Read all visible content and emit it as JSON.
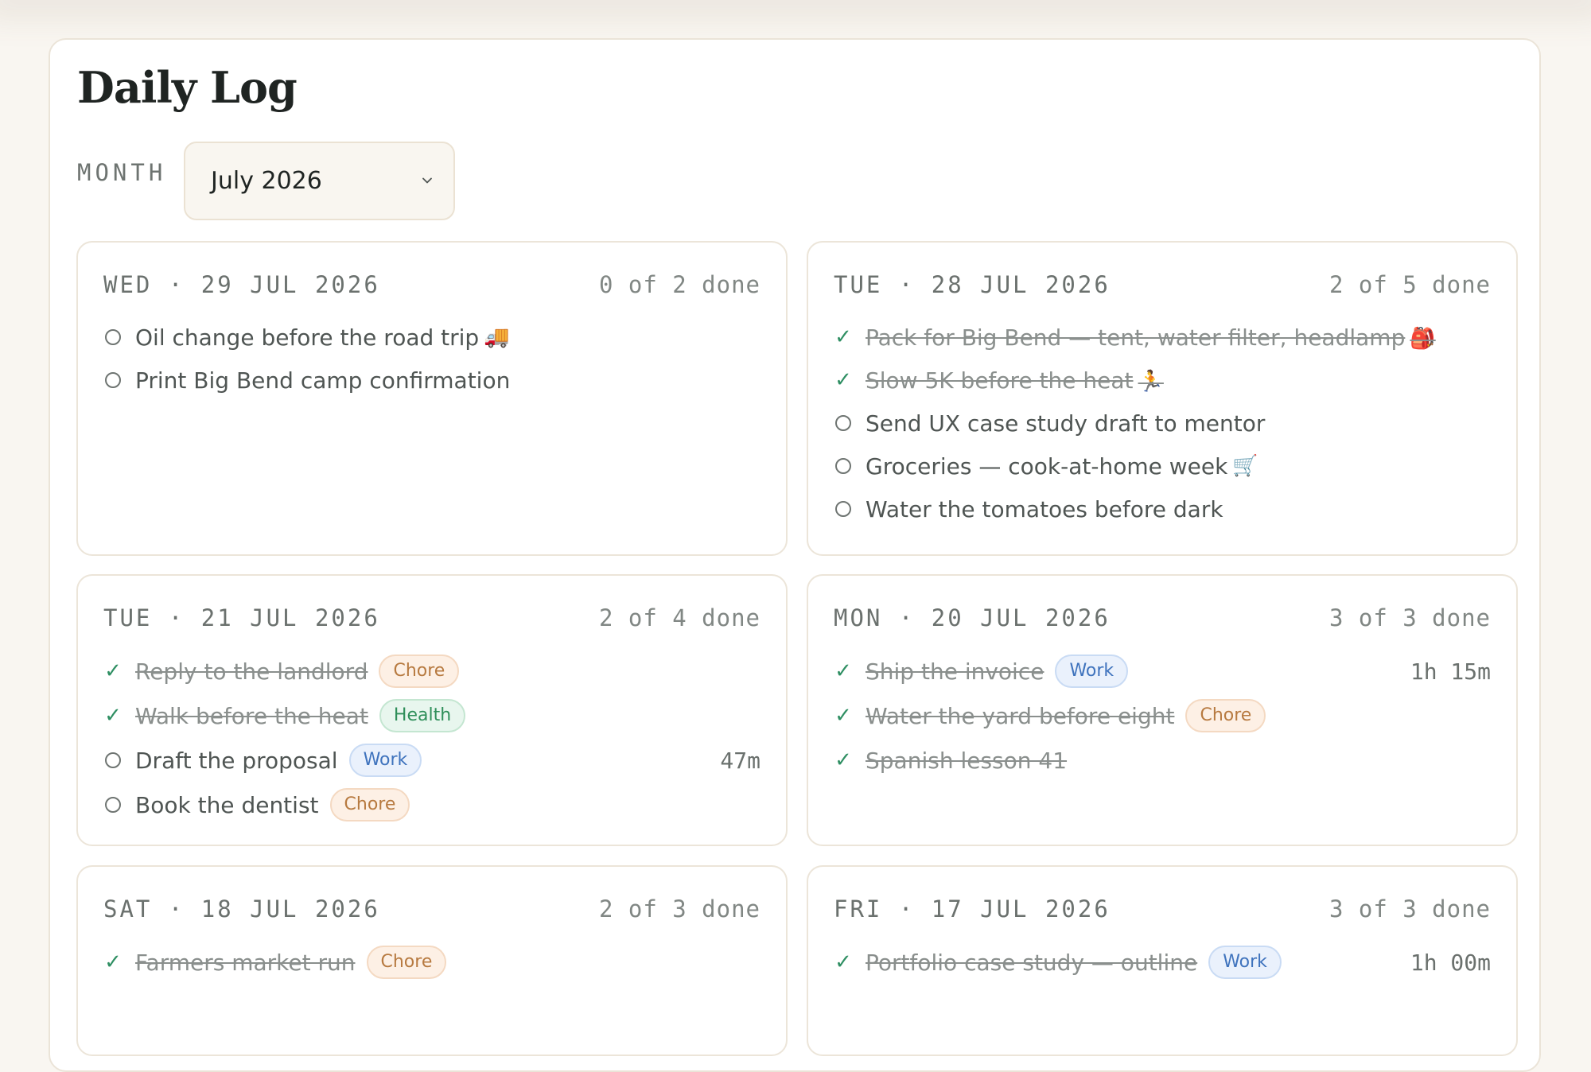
{
  "app": {
    "title": "Daily Log",
    "month_label": "MONTH",
    "month_value": "July 2026"
  },
  "colors": {
    "background": "#f9f6f1",
    "done_check": "#2f8f63",
    "tag_chore": "#b77a40",
    "tag_work": "#3f73bd",
    "tag_health": "#2f8f5a"
  },
  "days": [
    {
      "date": "WED · 29 JUL 2026",
      "count": "0 of 2 done",
      "tasks": [
        {
          "text": "Oil change before the road trip",
          "emoji": "🚚",
          "done": false
        },
        {
          "text": "Print Big Bend camp confirmation",
          "done": false
        }
      ]
    },
    {
      "date": "TUE · 28 JUL 2026",
      "count": "2 of 5 done",
      "tasks": [
        {
          "text": "Pack for Big Bend — tent, water filter, headlamp",
          "emoji": "🎒",
          "done": true
        },
        {
          "text": "Slow 5K before the heat",
          "emoji": "🏃",
          "done": true
        },
        {
          "text": "Send UX case study draft to mentor",
          "done": false
        },
        {
          "text": "Groceries — cook-at-home week",
          "emoji": "🛒",
          "done": false
        },
        {
          "text": "Water the tomatoes before dark",
          "done": false
        }
      ]
    },
    {
      "date": "TUE · 21 JUL 2026",
      "count": "2 of 4 done",
      "tasks": [
        {
          "text": "Reply to the landlord",
          "tag": "Chore",
          "done": true
        },
        {
          "text": "Walk before the heat",
          "tag": "Health",
          "done": true
        },
        {
          "text": "Draft the proposal",
          "tag": "Work",
          "duration": "47m",
          "done": false
        },
        {
          "text": "Book the dentist",
          "tag": "Chore",
          "done": false
        }
      ]
    },
    {
      "date": "MON · 20 JUL 2026",
      "count": "3 of 3 done",
      "tasks": [
        {
          "text": "Ship the invoice",
          "tag": "Work",
          "duration": "1h 15m",
          "done": true
        },
        {
          "text": "Water the yard before eight",
          "tag": "Chore",
          "done": true
        },
        {
          "text": "Spanish lesson 41",
          "done": true
        }
      ]
    },
    {
      "date": "SAT · 18 JUL 2026",
      "count": "2 of 3 done",
      "tasks": [
        {
          "text": "Farmers market run",
          "tag": "Chore",
          "done": true
        }
      ]
    },
    {
      "date": "FRI · 17 JUL 2026",
      "count": "3 of 3 done",
      "tasks": [
        {
          "text": "Portfolio case study — outline",
          "tag": "Work",
          "duration": "1h 00m",
          "done": true
        }
      ]
    }
  ]
}
